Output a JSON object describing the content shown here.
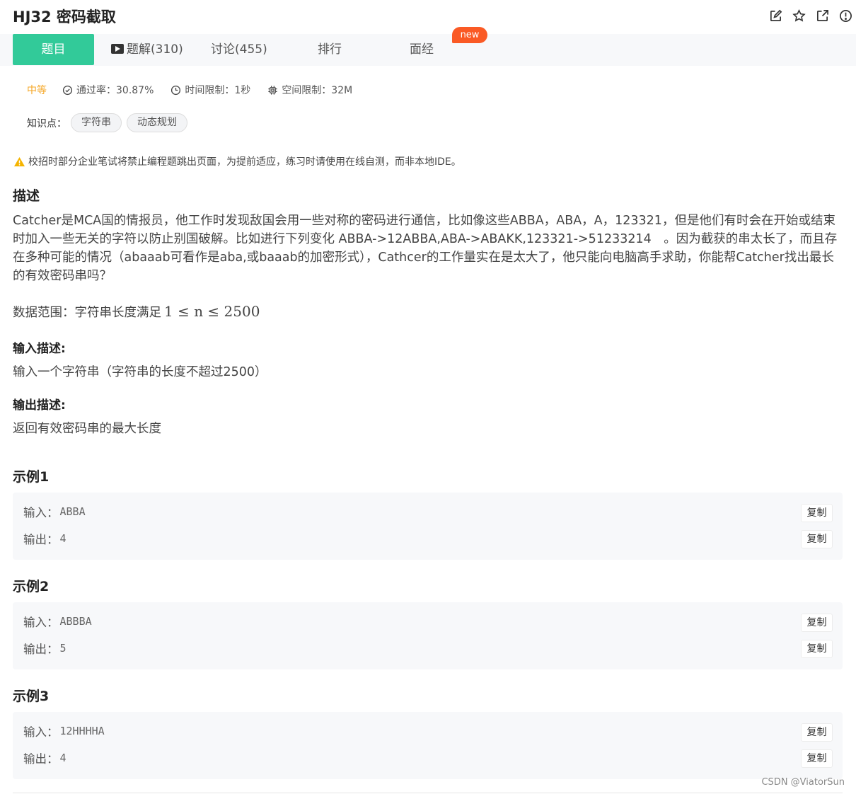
{
  "header": {
    "title": "HJ32  密码截取",
    "icons": [
      "edit-icon",
      "star-icon",
      "share-icon",
      "info-icon"
    ]
  },
  "tabs": {
    "problem": "题目",
    "solutions": "题解(310)",
    "discuss": "讨论(455)",
    "ranking": "排行",
    "interview": "面经",
    "new_badge": "new"
  },
  "meta": {
    "difficulty": "中等",
    "pass_rate": "通过率：30.87%",
    "time_limit": "时间限制：1秒",
    "space_limit": "空间限制：32M"
  },
  "knowledge": {
    "label": "知识点：",
    "tags": [
      "字符串",
      "动态规划"
    ]
  },
  "notice": "校招时部分企业笔试将禁止编程题跳出页面，为提前适应，练习时请使用在线自测，而非本地IDE。",
  "description": {
    "heading": "描述",
    "text": "Catcher是MCA国的情报员，他工作时发现敌国会用一些对称的密码进行通信，比如像这些ABBA，ABA，A，123321，但是他们有时会在开始或结束时加入一些无关的字符以防止别国破解。比如进行下列变化 ABBA->12ABBA,ABA->ABAKK,123321->51233214　。因为截获的串太长了，而且存在多种可能的情况（abaaab可看作是aba,或baaab的加密形式），Cathcer的工作量实在是太大了，他只能向电脑高手求助，你能帮Catcher找出最长的有效密码串吗？",
    "range_label": "数据范围：字符串长度满足",
    "range_math": "1 ≤ n ≤ 2500"
  },
  "input_desc": {
    "heading": "输入描述:",
    "text": "输入一个字符串（字符串的长度不超过2500）"
  },
  "output_desc": {
    "heading": "输出描述:",
    "text": "返回有效密码串的最大长度"
  },
  "examples": [
    {
      "title": "示例1",
      "input_label": "输入：",
      "input": "ABBA",
      "output_label": "输出：",
      "output": "4",
      "copy": "复制"
    },
    {
      "title": "示例2",
      "input_label": "输入：",
      "input": "ABBBA",
      "output_label": "输出：",
      "output": "5",
      "copy": "复制"
    },
    {
      "title": "示例3",
      "input_label": "输入：",
      "input": "12HHHHA",
      "output_label": "输出：",
      "output": "4",
      "copy": "复制"
    }
  ],
  "watermark": "CSDN @ViatorSun",
  "colors": {
    "accent": "#32ca99",
    "badge": "#fa5a25",
    "difficulty": "#f5a623",
    "warning": "#f5b400"
  }
}
